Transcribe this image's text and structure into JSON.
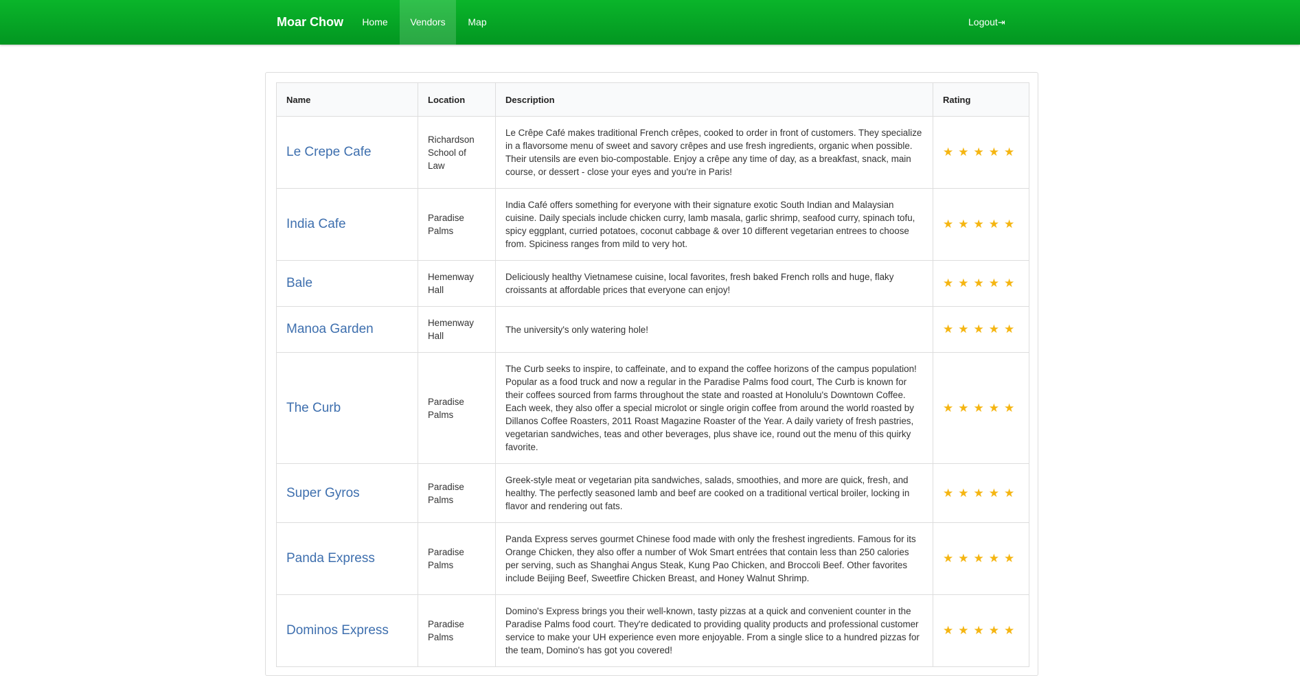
{
  "navbar": {
    "brand": "Moar Chow",
    "home": "Home",
    "vendors": "Vendors",
    "map": "Map",
    "logout": "Logout",
    "logout_icon": "sign-out-icon",
    "active_tab": "Vendors",
    "accent_color": "#02a623"
  },
  "table": {
    "headers": {
      "name": "Name",
      "location": "Location",
      "description": "Description",
      "rating": "Rating"
    },
    "star_color": "#f5b511",
    "rows": [
      {
        "name": "Le Crepe Cafe",
        "location": "Richardson School of Law",
        "description": "Le Crêpe Café makes traditional French crêpes, cooked to order in front of customers. They specialize in a flavorsome menu of sweet and savory crêpes and use fresh ingredients, organic when possible. Their utensils are even bio-compostable. Enjoy a crêpe any time of day, as a breakfast, snack, main course, or dessert - close your eyes and you're in Paris!",
        "rating": 5,
        "stars": "★★★★★"
      },
      {
        "name": "India Cafe",
        "location": "Paradise Palms",
        "description": "India Café offers something for everyone with their signature exotic South Indian and Malaysian cuisine. Daily specials include chicken curry, lamb masala, garlic shrimp, seafood curry, spinach tofu, spicy eggplant, curried potatoes, coconut cabbage & over 10 different vegetarian entrees to choose from. Spiciness ranges from mild to very hot.",
        "rating": 5,
        "stars": "★★★★★"
      },
      {
        "name": "Bale",
        "location": "Hemenway Hall",
        "description": "Deliciously healthy Vietnamese cuisine, local favorites, fresh baked French rolls and huge, flaky croissants at affordable prices that everyone can enjoy!",
        "rating": 5,
        "stars": "★★★★★"
      },
      {
        "name": "Manoa Garden",
        "location": "Hemenway Hall",
        "description": "The university's only watering hole!",
        "rating": 5,
        "stars": "★★★★★"
      },
      {
        "name": "The Curb",
        "location": "Paradise Palms",
        "description": "The Curb seeks to inspire, to caffeinate, and to expand the coffee horizons of the campus population! Popular as a food truck and now a regular in the Paradise Palms food court, The Curb is known for their coffees sourced from farms throughout the state and roasted at Honolulu's Downtown Coffee. Each week, they also offer a special microlot or single origin coffee from around the world roasted by Dillanos Coffee Roasters, 2011 Roast Magazine Roaster of the Year. A daily variety of fresh pastries, vegetarian sandwiches, teas and other beverages, plus shave ice, round out the menu of this quirky favorite.",
        "rating": 5,
        "stars": "★★★★★"
      },
      {
        "name": "Super Gyros",
        "location": "Paradise Palms",
        "description": "Greek-style meat or vegetarian pita sandwiches, salads, smoothies, and more are quick, fresh, and healthy. The perfectly seasoned lamb and beef are cooked on a traditional vertical broiler, locking in flavor and rendering out fats.",
        "rating": 5,
        "stars": "★★★★★"
      },
      {
        "name": "Panda Express",
        "location": "Paradise Palms",
        "description": "Panda Express serves gourmet Chinese food made with only the freshest ingredients. Famous for its Orange Chicken, they also offer a number of Wok Smart entrées that contain less than 250 calories per serving, such as Shanghai Angus Steak, Kung Pao Chicken, and Broccoli Beef. Other favorites include Beijing Beef, Sweetfire Chicken Breast, and Honey Walnut Shrimp.",
        "rating": 5,
        "stars": "★★★★★"
      },
      {
        "name": "Dominos Express",
        "location": "Paradise Palms",
        "description": "Domino's Express brings you their well-known, tasty pizzas at a quick and convenient counter in the Paradise Palms food court. They're dedicated to providing quality products and professional customer service to make your UH experience even more enjoyable. From a single slice to a hundred pizzas for the team, Domino's has got you covered!",
        "rating": 5,
        "stars": "★★★★★"
      }
    ]
  }
}
